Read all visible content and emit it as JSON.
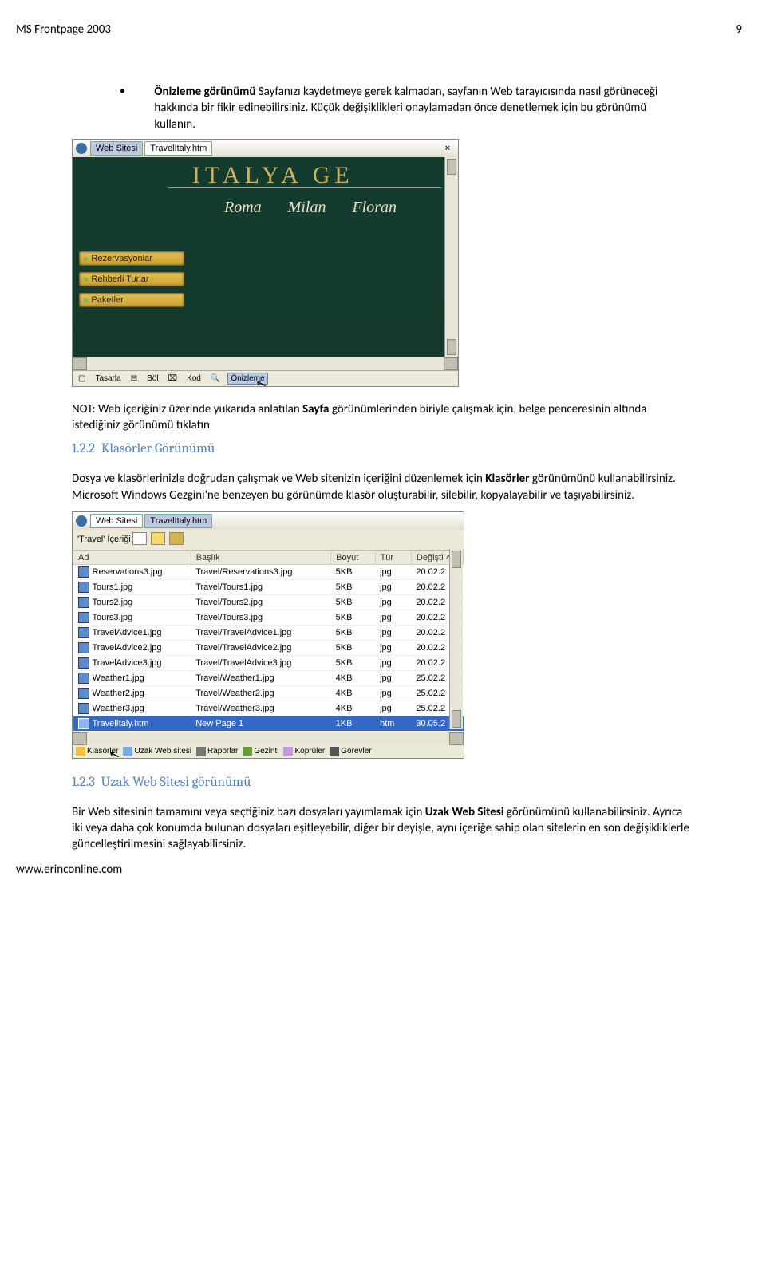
{
  "header": {
    "left": "MS Frontpage 2003",
    "page_number": "9"
  },
  "bullet": {
    "lead_bold": "Önizleme görünümü ",
    "rest": "Sayfanızı kaydetmeye gerek kalmadan, sayfanın Web tarayıcısında nasıl görüneceği hakkında bir fikir edinebilirsiniz. Küçük değişiklikleri onaylamadan önce denetlemek için bu görünümü kullanın."
  },
  "screenshot1": {
    "tabs": {
      "site": "Web Sitesi",
      "file": "TravelItaly.htm",
      "close": "×"
    },
    "hero_title": "ITALYA GE",
    "cities": [
      "Roma",
      "Milan",
      "Floran"
    ],
    "nav": [
      "Rezervasyonlar",
      "Rehberli Turlar",
      "Paketler"
    ],
    "view_buttons": {
      "tasarla": "Tasarla",
      "bol": "Böl",
      "kod": "Kod",
      "onizleme": "Önizleme"
    }
  },
  "note": {
    "pre": "NOT: Web içeriğiniz üzerinde yukarıda anlatılan ",
    "bold": "Sayfa ",
    "post": "görünümlerinden biriyle çalışmak için, belge penceresinin altında istediğiniz görünümü tıklatın"
  },
  "h122": {
    "num": "1.2.2",
    "title": "Klasörler Görünümü"
  },
  "p122": {
    "pre": "Dosya ve klasörlerinizle doğrudan çalışmak ve Web sitenizin içeriğini düzenlemek için ",
    "bold": "Klasörler ",
    "post": "görünümünü kullanabilirsiniz. Microsoft Windows Gezgini'ne benzeyen bu görünümde klasör oluşturabilir, silebilir, kopyalayabilir ve taşıyabilirsiniz."
  },
  "screenshot2": {
    "tabs": {
      "site": "Web Sitesi",
      "file": "TravelItaly.htm"
    },
    "subtitle": "'Travel' İçeriği",
    "columns": {
      "ad": "Ad",
      "baslik": "Başlık",
      "boyut": "Boyut",
      "tur": "Tür",
      "degisti": "Değişti"
    },
    "rows": [
      {
        "ad": "Reservations3.jpg",
        "baslik": "Travel/Reservations3.jpg",
        "boyut": "5KB",
        "tur": "jpg",
        "date": "20.02.2"
      },
      {
        "ad": "Tours1.jpg",
        "baslik": "Travel/Tours1.jpg",
        "boyut": "5KB",
        "tur": "jpg",
        "date": "20.02.2"
      },
      {
        "ad": "Tours2.jpg",
        "baslik": "Travel/Tours2.jpg",
        "boyut": "5KB",
        "tur": "jpg",
        "date": "20.02.2"
      },
      {
        "ad": "Tours3.jpg",
        "baslik": "Travel/Tours3.jpg",
        "boyut": "5KB",
        "tur": "jpg",
        "date": "20.02.2"
      },
      {
        "ad": "TravelAdvice1.jpg",
        "baslik": "Travel/TravelAdvice1.jpg",
        "boyut": "5KB",
        "tur": "jpg",
        "date": "20.02.2"
      },
      {
        "ad": "TravelAdvice2.jpg",
        "baslik": "Travel/TravelAdvice2.jpg",
        "boyut": "5KB",
        "tur": "jpg",
        "date": "20.02.2"
      },
      {
        "ad": "TravelAdvice3.jpg",
        "baslik": "Travel/TravelAdvice3.jpg",
        "boyut": "5KB",
        "tur": "jpg",
        "date": "20.02.2"
      },
      {
        "ad": "Weather1.jpg",
        "baslik": "Travel/Weather1.jpg",
        "boyut": "4KB",
        "tur": "jpg",
        "date": "25.02.2"
      },
      {
        "ad": "Weather2.jpg",
        "baslik": "Travel/Weather2.jpg",
        "boyut": "4KB",
        "tur": "jpg",
        "date": "25.02.2"
      },
      {
        "ad": "Weather3.jpg",
        "baslik": "Travel/Weather3.jpg",
        "boyut": "4KB",
        "tur": "jpg",
        "date": "25.02.2"
      },
      {
        "ad": "TravelItaly.htm",
        "baslik": "New Page 1",
        "boyut": "1KB",
        "tur": "htm",
        "date": "30.05.2",
        "selected": true
      }
    ],
    "footer_buttons": [
      "Klasörler",
      "Uzak Web sitesi",
      "Raporlar",
      "Gezinti",
      "Köprüler",
      "Görevler"
    ]
  },
  "h123": {
    "num": "1.2.3",
    "title": "Uzak Web Sitesi görünümü"
  },
  "p123": {
    "pre": "Bir Web sitesinin tamamını veya seçtiğiniz bazı dosyaları yayımlamak için ",
    "bold": "Uzak Web Sitesi ",
    "post": "görünümünü kullanabilirsiniz. Ayrıca iki veya daha çok konumda bulunan dosyaları eşitleyebilir, diğer bir deyişle, aynı içeriğe sahip olan sitelerin en son değişikliklerle güncelleştirilmesini sağlayabilirsiniz."
  },
  "footer": "www.erinconline.com"
}
